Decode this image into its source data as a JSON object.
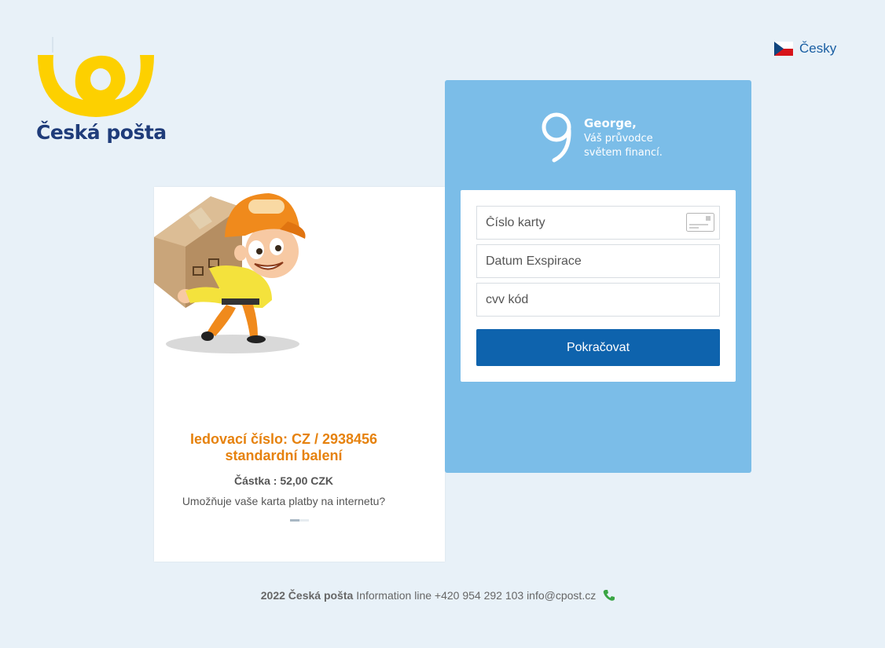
{
  "brand": {
    "name": "Česká pošta",
    "colors": {
      "yellow": "#fdd000",
      "navy": "#1f3c7a",
      "orange": "#e6820e",
      "blue": "#0e63ad",
      "panel": "#7bbde8"
    }
  },
  "language": {
    "label": "Česky",
    "flag_icon": "czech-flag-icon"
  },
  "left_card": {
    "tracking": "Iedovací číslo: CZ / 2938456",
    "package": "standardní balení",
    "amount": "Částka : 52,00 CZK",
    "question": "Umožňuje vaše karta platby na internetu?"
  },
  "george": {
    "title": "George,",
    "subtitle_line1": "Váš průvodce",
    "subtitle_line2": "světem financí."
  },
  "form": {
    "card_number_placeholder": "Číslo karty",
    "expiry_placeholder": "Datum Exspirace",
    "cvv_placeholder": "cvv kód",
    "submit_label": "Pokračovat"
  },
  "footer": {
    "copyright": "2022 Česká pošta",
    "info": "Information line +420 954 292 103 info@cpost.cz",
    "phone_icon": "phone-icon"
  }
}
